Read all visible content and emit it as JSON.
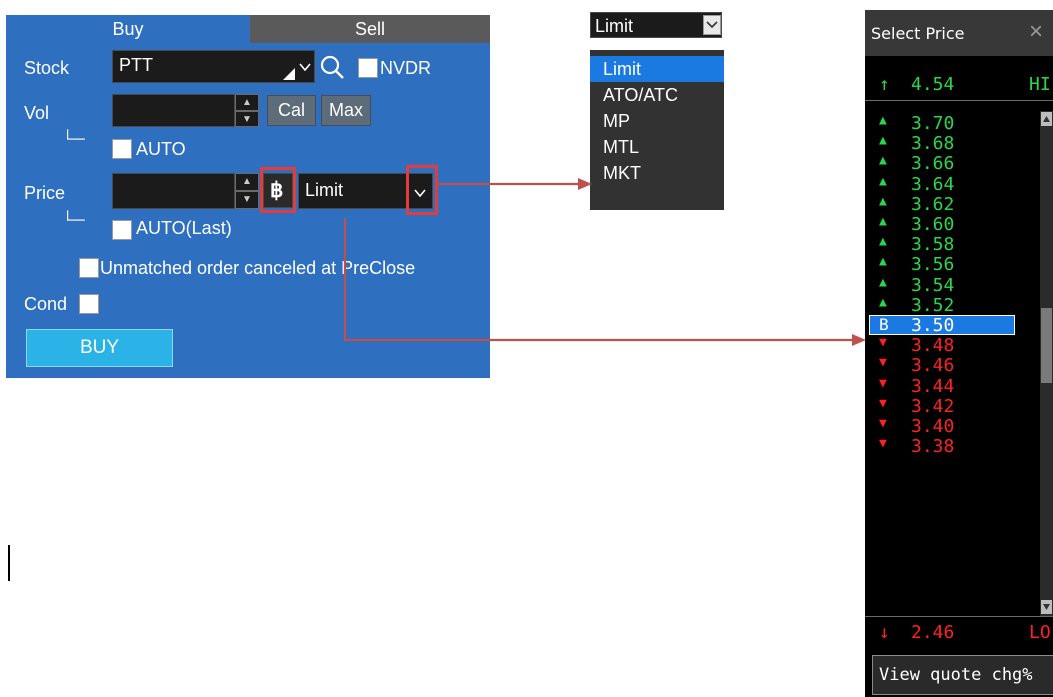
{
  "order_panel": {
    "tabs": {
      "buy": "Buy",
      "sell": "Sell"
    },
    "stock": {
      "label": "Stock",
      "value": "PTT",
      "nvdr_label": "NVDR"
    },
    "vol": {
      "label": "Vol",
      "value": "",
      "cal_label": "Cal",
      "max_label": "Max",
      "auto_label": "AUTO"
    },
    "price": {
      "label": "Price",
      "value": "",
      "icon_glyph": "฿",
      "type_value": "Limit",
      "auto_last_label": "AUTO(Last)"
    },
    "unmatched_label": "Unmatched order canceled at PreClose",
    "cond_label": "Cond",
    "buy_button": "BUY"
  },
  "order_type_dropdown": {
    "selected": "Limit",
    "options": [
      "Limit",
      "ATO/ATC",
      "MP",
      "MTL",
      "MKT"
    ],
    "highlighted_index": 0
  },
  "select_price": {
    "title": "Select Price",
    "close_glyph": "×",
    "high": {
      "arrow": "↑",
      "value": "4.54",
      "tag": "HI"
    },
    "rows": [
      {
        "mark": "▲",
        "value": "3.70",
        "kind": "up"
      },
      {
        "mark": "▲",
        "value": "3.68",
        "kind": "up"
      },
      {
        "mark": "▲",
        "value": "3.66",
        "kind": "up"
      },
      {
        "mark": "▲",
        "value": "3.64",
        "kind": "up"
      },
      {
        "mark": "▲",
        "value": "3.62",
        "kind": "up"
      },
      {
        "mark": "▲",
        "value": "3.60",
        "kind": "up"
      },
      {
        "mark": "▲",
        "value": "3.58",
        "kind": "up"
      },
      {
        "mark": "▲",
        "value": "3.56",
        "kind": "up"
      },
      {
        "mark": "▲",
        "value": "3.54",
        "kind": "up"
      },
      {
        "mark": "▲",
        "value": "3.52",
        "kind": "up"
      },
      {
        "mark": "B",
        "value": "3.50",
        "kind": "base"
      },
      {
        "mark": "▼",
        "value": "3.48",
        "kind": "down"
      },
      {
        "mark": "▼",
        "value": "3.46",
        "kind": "down"
      },
      {
        "mark": "▼",
        "value": "3.44",
        "kind": "down"
      },
      {
        "mark": "▼",
        "value": "3.42",
        "kind": "down"
      },
      {
        "mark": "▼",
        "value": "3.40",
        "kind": "down"
      },
      {
        "mark": "▼",
        "value": "3.38",
        "kind": "down"
      }
    ],
    "low": {
      "arrow": "↓",
      "value": "2.46",
      "tag": "LO"
    },
    "view_quote_label": "View quote chg%"
  },
  "colors": {
    "panel_blue": "#2f6fc0",
    "buy_button": "#2bb3e8",
    "up_green": "#27d84a",
    "down_red": "#ff2020",
    "select_blue": "#1a7ae2",
    "annotation_red": "#c0504d"
  },
  "icons": {
    "search": "search-icon",
    "chevron": "chevron-down-icon",
    "baht": "baht-icon",
    "close": "close-icon"
  }
}
